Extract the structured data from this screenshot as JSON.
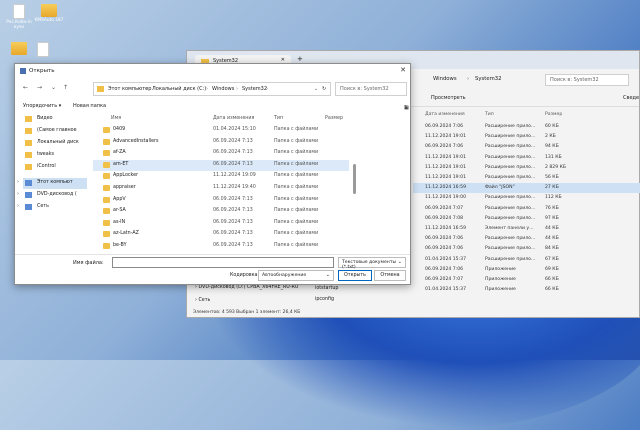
{
  "desktop": {
    "icons": [
      {
        "label": "Рес.Кобн-in кучн"
      },
      {
        "label": "KMSAuto.187"
      }
    ]
  },
  "bg_window": {
    "tab_title": "System32",
    "crumbs": [
      "Windows",
      "System32"
    ],
    "search_placeholder": "Поиск в: System32",
    "cmd": [
      "Просмотреть",
      "Сведе"
    ],
    "headers": [
      "Дата изменения",
      "Тип",
      "Размер"
    ],
    "rows": [
      {
        "date": "06.09.2024 7:06",
        "type": "Расширение прило...",
        "size": "60 КБ"
      },
      {
        "date": "11.12.2024 19:01",
        "type": "Расширение прило...",
        "size": "2 КБ"
      },
      {
        "date": "06.09.2024 7:06",
        "type": "Расширение прило...",
        "size": "94 КБ"
      },
      {
        "date": "11.12.2024 19:01",
        "type": "Расширение прило...",
        "size": "131 КБ"
      },
      {
        "date": "11.12.2024 19:01",
        "type": "Расширение прило...",
        "size": "2 829 КБ"
      },
      {
        "date": "11.12.2024 19:01",
        "type": "Расширение прило...",
        "size": "56 КБ"
      },
      {
        "date": "11.12.2024 16:59",
        "type": "Файл \"JSON\"",
        "size": "27 КБ"
      },
      {
        "date": "11.12.2024 19:00",
        "type": "Расширение прило...",
        "size": "112 КБ"
      },
      {
        "date": "06.09.2024 7:07",
        "type": "Расширение прило...",
        "size": "76 КБ"
      },
      {
        "date": "06.09.2024 7:08",
        "type": "Расширение прило...",
        "size": "97 КБ"
      },
      {
        "date": "11.12.2024 16:59",
        "type": "Элемент панели у...",
        "size": "44 КБ"
      },
      {
        "date": "06.09.2024 7:06",
        "type": "Расширение прило...",
        "size": "44 КБ"
      },
      {
        "date": "06.09.2024 7:06",
        "type": "Расширение прило...",
        "size": "84 КБ"
      },
      {
        "date": "01.04.2024 15:37",
        "type": "Расширение прило...",
        "size": "67 КБ"
      },
      {
        "date": "06.09.2024 7:06",
        "type": "Приложение",
        "size": "69 КБ"
      },
      {
        "date": "06.09.2024 7:07",
        "type": "Приложение",
        "size": "66 КБ"
      },
      {
        "date": "01.04.2024 15:37",
        "type": "Приложение",
        "size": "66 КБ"
      }
    ],
    "nav_items": [
      "DVD-дисковод (D:) CPBA_X64FRE_RU-RU",
      "Сеть"
    ],
    "files": [
      "iotstartup",
      "ipconfig"
    ],
    "status": "Элементов: 4 593    Выбран 1 элемент: 26,4 КБ"
  },
  "dialog": {
    "title": "Открыть",
    "address": [
      "Этот компьютер",
      "Локальный диск (C:)",
      "Windows",
      "System32"
    ],
    "search_placeholder": "Поиск в: System32",
    "organize": "Упорядочить ▾",
    "new_folder": "Новая папка",
    "columns": [
      "Имя",
      "Дата изменения",
      "Тип",
      "Размер"
    ],
    "sidebar": [
      {
        "label": "Видео",
        "kind": "folder"
      },
      {
        "label": "(Самое главное",
        "kind": "folder"
      },
      {
        "label": "Локальный диск",
        "kind": "folder"
      },
      {
        "label": "tweaks",
        "kind": "folder"
      },
      {
        "label": "iControl",
        "kind": "folder"
      },
      {
        "label": "Этот компьют",
        "kind": "pc"
      },
      {
        "label": "DVD-дисковод (",
        "kind": "pc"
      },
      {
        "label": "Сеть",
        "kind": "pc"
      }
    ],
    "rows": [
      {
        "name": "0409",
        "date": "01.04.2024 15:10",
        "type": "Папка с файлами"
      },
      {
        "name": "AdvancedInstallers",
        "date": "06.09.2024 7:13",
        "type": "Папка с файлами"
      },
      {
        "name": "af-ZA",
        "date": "06.09.2024 7:13",
        "type": "Папка с файлами"
      },
      {
        "name": "am-ET",
        "date": "06.09.2024 7:13",
        "type": "Папка с файлами"
      },
      {
        "name": "AppLocker",
        "date": "11.12.2024 19:09",
        "type": "Папка с файлами"
      },
      {
        "name": "appraiser",
        "date": "11.12.2024 19:40",
        "type": "Папка с файлами"
      },
      {
        "name": "AppV",
        "date": "06.09.2024 7:13",
        "type": "Папка с файлами"
      },
      {
        "name": "ar-SA",
        "date": "06.09.2024 7:13",
        "type": "Папка с файлами"
      },
      {
        "name": "as-IN",
        "date": "06.09.2024 7:13",
        "type": "Папка с файлами"
      },
      {
        "name": "az-Latn-AZ",
        "date": "06.09.2024 7:13",
        "type": "Папка с файлами"
      },
      {
        "name": "be-BY",
        "date": "06.09.2024 7:13",
        "type": "Папка с файлами"
      }
    ],
    "filename_label": "Имя файла:",
    "filter_value": "Текстовые документы (*.txt)",
    "encoding_label": "Кодировка:",
    "encoding_value": "Автообнаружение",
    "open_label": "Открыть",
    "cancel_label": "Отмена"
  }
}
